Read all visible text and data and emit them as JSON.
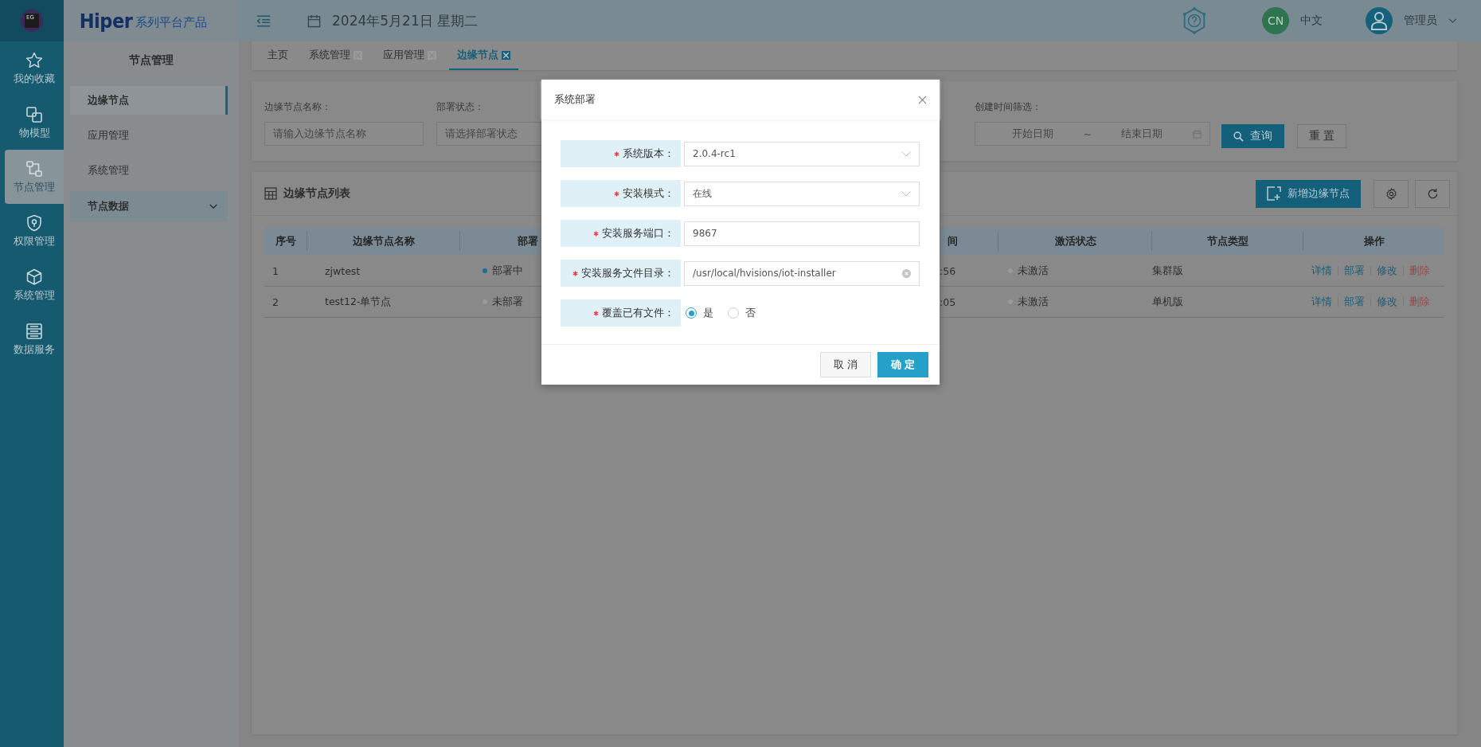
{
  "logo": {
    "text": "EG"
  },
  "brand": {
    "name": "Hiper",
    "subtitle": "系列平台产品"
  },
  "header": {
    "date": "2024年5月21日 星期二",
    "language_badge": "CN",
    "language": "中文",
    "user": "管理员"
  },
  "nav_rail": [
    {
      "label": "我的收藏",
      "selected": false
    },
    {
      "label": "物模型",
      "selected": false
    },
    {
      "label": "节点管理",
      "selected": true
    },
    {
      "label": "权限管理",
      "selected": false
    },
    {
      "label": "系统管理",
      "selected": false
    },
    {
      "label": "数据服务",
      "selected": false
    }
  ],
  "sidebar": {
    "title": "节点管理",
    "items": [
      {
        "label": "边缘节点",
        "kind": "link",
        "selected": true
      },
      {
        "label": "应用管理",
        "kind": "link",
        "selected": false
      },
      {
        "label": "系统管理",
        "kind": "link",
        "selected": false
      },
      {
        "label": "节点数据",
        "kind": "group",
        "selected": false,
        "expanded": false
      }
    ]
  },
  "tabs": [
    {
      "label": "主页",
      "closable": false,
      "selected": false
    },
    {
      "label": "系统管理",
      "closable": true,
      "selected": false
    },
    {
      "label": "应用管理",
      "closable": true,
      "selected": false
    },
    {
      "label": "边缘节点",
      "closable": true,
      "selected": true
    }
  ],
  "filters": [
    {
      "kind": "text",
      "label": "边缘节点名称：",
      "placeholder": "请输入边缘节点名称"
    },
    {
      "kind": "select",
      "label": "部署状态：",
      "placeholder": "请选择部署状态"
    },
    {
      "kind": "daterange",
      "label": "创建时间筛选：",
      "start_placeholder": "开始日期",
      "separator": "~",
      "end_placeholder": "结束日期"
    }
  ],
  "filter_buttons": [
    {
      "kind": "primary",
      "label": "查询"
    },
    {
      "kind": "default",
      "label": "重 置"
    }
  ],
  "list": {
    "title": "边缘节点列表",
    "add_button": "新增边缘节点"
  },
  "table": {
    "columns": [
      "序号",
      "边缘节点名称",
      "部署",
      "间",
      "激活状态",
      "节点类型",
      "操作"
    ],
    "rows": [
      {
        "index": "1",
        "name": "zjwtest",
        "deploy_status": {
          "text": "部署中",
          "color": "#17708e"
        },
        "created": ":56",
        "activation": {
          "text": "未激活",
          "color": "#9a9a9a"
        },
        "type": "集群版",
        "actions": [
          {
            "label": "详情",
            "kind": "link"
          },
          {
            "label": "部署",
            "kind": "link"
          },
          {
            "label": "修改",
            "kind": "link"
          },
          {
            "label": "删除",
            "kind": "danger"
          }
        ]
      },
      {
        "index": "2",
        "name": "test12-单节点",
        "deploy_status": {
          "text": "未部署",
          "color": "#9a9a9a"
        },
        "created": ":05",
        "activation": {
          "text": "未激活",
          "color": "#9a9a9a"
        },
        "type": "单机版",
        "actions": [
          {
            "label": "详情",
            "kind": "link"
          },
          {
            "label": "部署",
            "kind": "link"
          },
          {
            "label": "修改",
            "kind": "link"
          },
          {
            "label": "删除",
            "kind": "danger"
          }
        ]
      }
    ]
  },
  "dialog": {
    "title": "系统部署",
    "fields": [
      {
        "kind": "select",
        "label": "系统版本：",
        "required": true,
        "value": "2.0.4-rc1"
      },
      {
        "kind": "select",
        "label": "安装模式：",
        "required": true,
        "value": "在线"
      },
      {
        "kind": "text",
        "label": "安装服务端口：",
        "required": true,
        "value": "9867"
      },
      {
        "kind": "text",
        "label": "安装服务文件目录：",
        "required": true,
        "value": "/usr/local/hvisions/iot-installer",
        "clearable": true
      },
      {
        "kind": "radio",
        "label": "覆盖已有文件：",
        "required": true,
        "options": [
          {
            "label": "是",
            "selected": true
          },
          {
            "label": "否",
            "selected": false
          }
        ]
      }
    ],
    "buttons": [
      {
        "kind": "default",
        "label": "取 消"
      },
      {
        "kind": "primary",
        "label": "确 定"
      }
    ]
  }
}
